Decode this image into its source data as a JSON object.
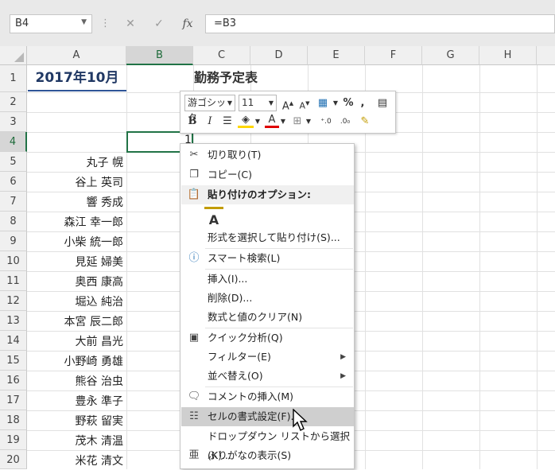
{
  "namebox": {
    "value": "B4",
    "dropdown_icon": "chevron-down-icon"
  },
  "formula_bar": {
    "cancel": "✕",
    "enter": "✓",
    "fx": "fx",
    "value": "=B3"
  },
  "columns": [
    "A",
    "B",
    "C",
    "D",
    "E",
    "F",
    "G",
    "H"
  ],
  "rows": [
    "1",
    "2",
    "3",
    "4",
    "5",
    "6",
    "7",
    "8",
    "9",
    "10",
    "11",
    "12",
    "13",
    "14",
    "15",
    "16",
    "17",
    "18",
    "19",
    "20"
  ],
  "cells": {
    "A1": "2017年10月",
    "C1": "勤務予定表",
    "C4": "1",
    "names": [
      "丸子 幌",
      "谷上 英司",
      "響 秀成",
      "森江 幸一郎",
      "小柴 統一郎",
      "見延 婦美",
      "奥西 康高",
      "堀込 純治",
      "本宮 辰二郎",
      "大前 昌光",
      "小野崎 勇雄",
      "熊谷 治虫",
      "豊永 準子",
      "野萩 留実",
      "茂木 清温",
      "米花 清文"
    ]
  },
  "mini_toolbar": {
    "font": "游ゴシック",
    "size": "11",
    "percent": "%",
    "comma": ",",
    "bold": "B",
    "italic": "I",
    "font_color": "A",
    "accent_fill": "#ffd700",
    "accent_font": "#e00000"
  },
  "context_menu": {
    "cut": "切り取り(T)",
    "copy": "コピー(C)",
    "paste_options": "貼り付けのオプション:",
    "paste_special": "形式を選択して貼り付け(S)...",
    "smart_lookup": "スマート検索(L)",
    "insert": "挿入(I)...",
    "delete": "削除(D)...",
    "clear": "数式と値のクリア(N)",
    "quick_analysis": "クイック分析(Q)",
    "filter": "フィルター(E)",
    "sort": "並べ替え(O)",
    "insert_comment": "コメントの挿入(M)",
    "format_cells": "セルの書式設定(F)...",
    "dropdown_list": "ドロップダウン リストから選択(K)...",
    "phonetic": "ふりがなの表示(S)"
  },
  "colors": {
    "excel_green": "#217346",
    "title_blue": "#203864"
  }
}
